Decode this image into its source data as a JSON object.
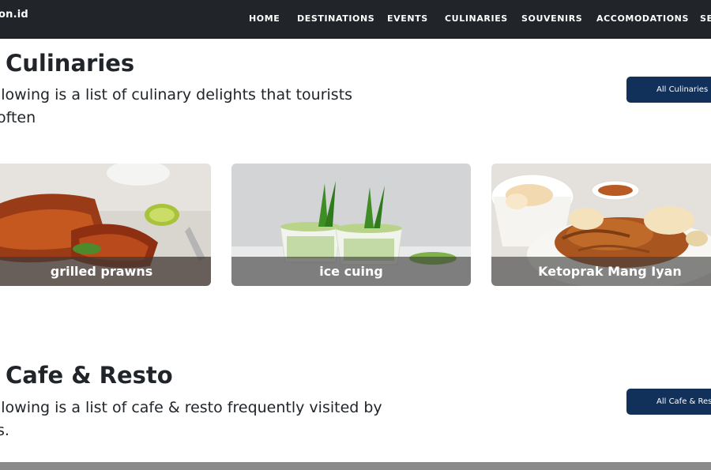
{
  "navbar": {
    "brand": "on.id",
    "items": [
      "HOME",
      "DESTINATIONS",
      "EVENTS",
      "CULINARIES",
      "SOUVENIRS",
      "ACCOMODATIONS",
      "SE"
    ]
  },
  "culinaries": {
    "title": "Culinaries",
    "description": "llowing is a list of culinary delights that tourists often",
    "button_label": "All Culinaries",
    "cards": [
      {
        "label": "grilled prawns"
      },
      {
        "label": "ice cuing"
      },
      {
        "label": "Ketoprak Mang Iyan"
      }
    ]
  },
  "cafe_resto": {
    "title": "Cafe & Resto",
    "description_line1": "llowing is a list of cafe & resto frequently visited by",
    "description_line2": "s.",
    "button_label": "All Cafe & Resto"
  },
  "colors": {
    "navbar_bg": "#212529",
    "button_bg": "#11305a",
    "label_overlay": "rgba(60,60,60,0.62)"
  }
}
